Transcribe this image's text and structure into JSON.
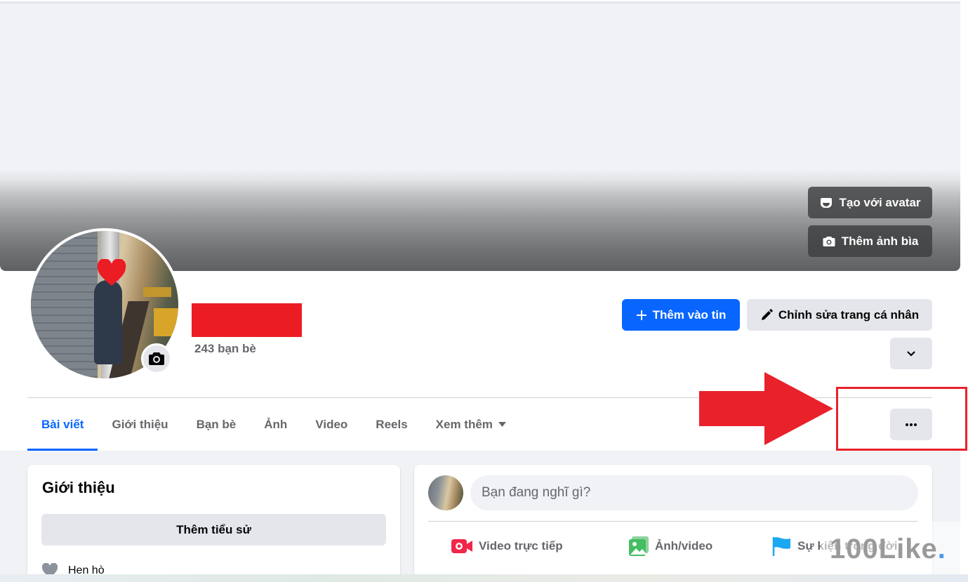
{
  "cover": {
    "avatar_button": "Tạo với avatar",
    "cover_button": "Thêm ảnh bìa"
  },
  "profile": {
    "friends_count": "243 bạn bè"
  },
  "actions": {
    "add_story": "Thêm vào tin",
    "edit_profile": "Chỉnh sửa trang cá nhân"
  },
  "tabs": [
    {
      "label": "Bài viết",
      "active": true
    },
    {
      "label": "Giới thiệu"
    },
    {
      "label": "Bạn bè"
    },
    {
      "label": "Ảnh"
    },
    {
      "label": "Video"
    },
    {
      "label": "Reels"
    },
    {
      "label": "Xem thêm"
    }
  ],
  "intro": {
    "title": "Giới thiệu",
    "add_bio": "Thêm tiểu sử",
    "status_item": "Hẹn hò"
  },
  "composer": {
    "placeholder": "Bạn đang nghĩ gì?",
    "live_video": "Video trực tiếp",
    "photo_video": "Ảnh/video",
    "life_event": "Sự kiện trong đời"
  },
  "watermark": {
    "text": "100Like",
    "dot": "."
  },
  "colors": {
    "primary": "#0866ff",
    "annotation_red": "#e8212b",
    "live_red": "#f02849",
    "photo_green": "#45bd62",
    "event_blue": "#1ba7f2"
  }
}
